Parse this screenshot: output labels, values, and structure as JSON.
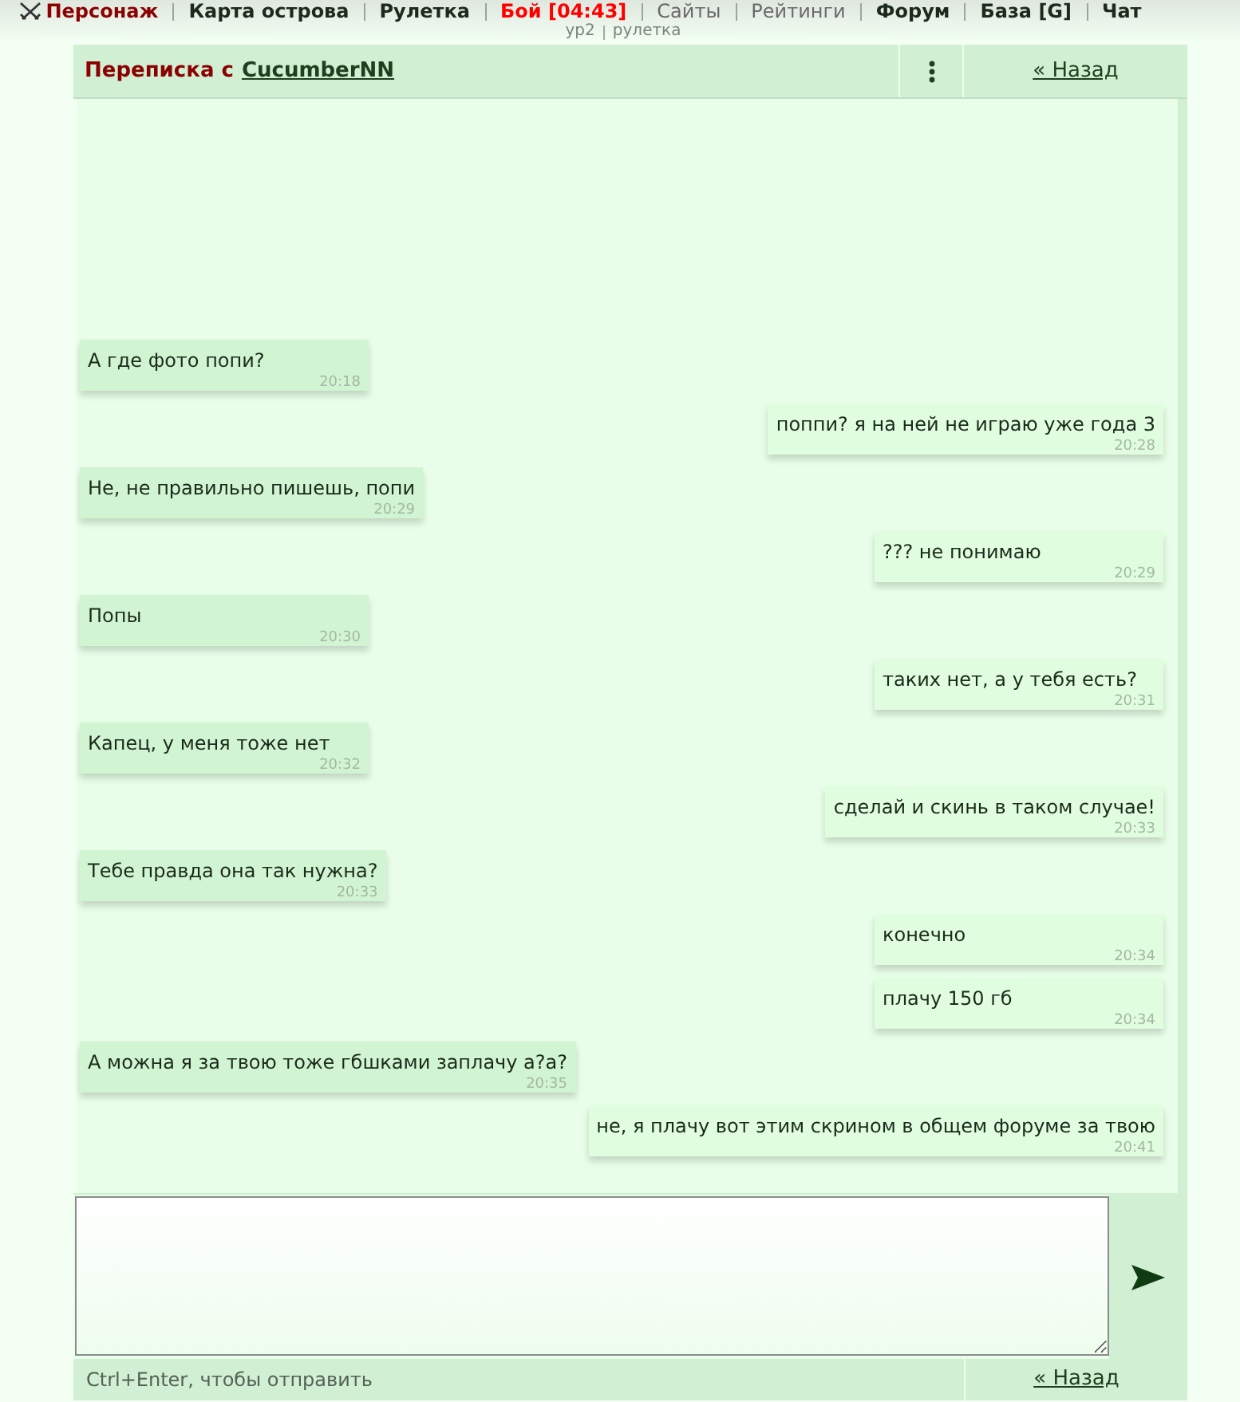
{
  "top_nav": {
    "items": [
      {
        "label": "Персонаж",
        "kind": "current"
      },
      {
        "label": "Карта острова",
        "kind": "bold"
      },
      {
        "label": "Рулетка",
        "kind": "bold"
      },
      {
        "label": "Бой [04:43]",
        "kind": "alert"
      },
      {
        "label": "Сайты",
        "kind": "plain"
      },
      {
        "label": "Рейтинги",
        "kind": "plain"
      },
      {
        "label": "Форум",
        "kind": "bold"
      },
      {
        "label": "База [G]",
        "kind": "bold"
      },
      {
        "label": "Чат",
        "kind": "bold"
      }
    ],
    "sub_links": [
      "ур2",
      "рулетка"
    ]
  },
  "conversation": {
    "title": "Переписка с",
    "partner": "CucumberNN",
    "back_link": "« Назад"
  },
  "messages": [
    {
      "kind": "incoming",
      "text": "А где фото попи?",
      "time": "20:18"
    },
    {
      "kind": "outgoing",
      "text": "поппи? я на ней не играю уже года 3",
      "time": "20:28"
    },
    {
      "kind": "incoming",
      "text": "Не, не правильно пишешь, попи",
      "time": "20:29"
    },
    {
      "kind": "outgoing",
      "text": "??? не понимаю",
      "time": "20:29"
    },
    {
      "kind": "incoming",
      "text": "Попы",
      "time": "20:30"
    },
    {
      "kind": "outgoing",
      "text": "таких нет, а у тебя есть?",
      "time": "20:31"
    },
    {
      "kind": "incoming",
      "text": "Капец, у меня тоже нет",
      "time": "20:32"
    },
    {
      "kind": "outgoing",
      "text": "сделай и скинь в таком случае!",
      "time": "20:33"
    },
    {
      "kind": "incoming",
      "text": "Тебе правда она так нужна?",
      "time": "20:33"
    },
    {
      "kind": "outgoing",
      "text": "конечно",
      "time": "20:34"
    },
    {
      "kind": "outgoing",
      "text": "плачу 150 гб",
      "time": "20:34"
    },
    {
      "kind": "incoming",
      "text": "А можна я за твою тоже гбшками заплачу а?а?",
      "time": "20:35"
    },
    {
      "kind": "outgoing",
      "text": "не, я плачу вот этим скрином в общем форуме за твою",
      "time": "20:41"
    }
  ],
  "composer": {
    "hint": "Ctrl+Enter, чтобы отправить",
    "back_link": "« Назад"
  }
}
